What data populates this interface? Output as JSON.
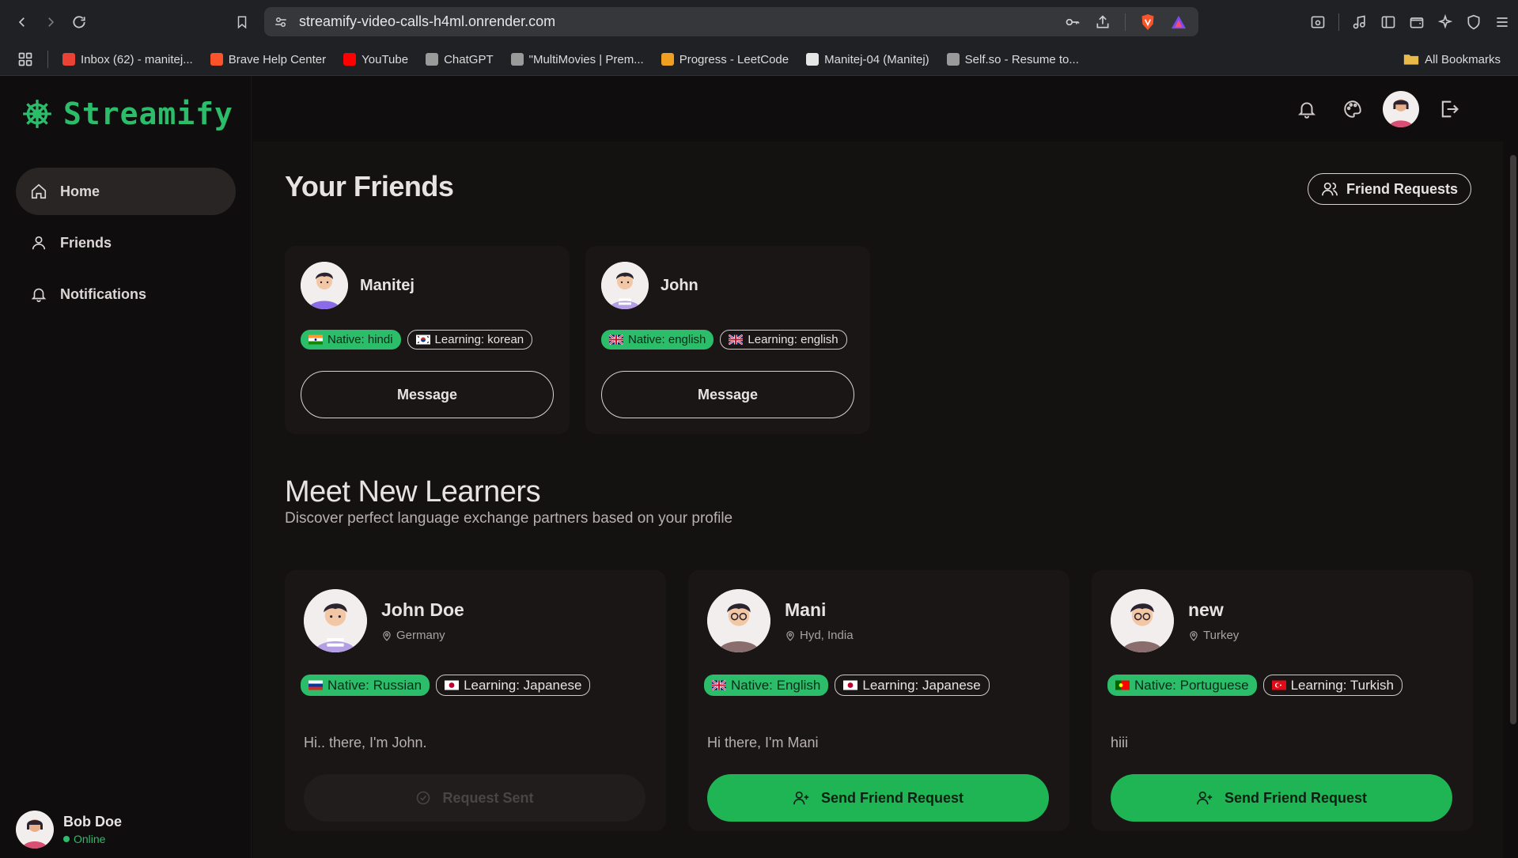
{
  "browser": {
    "url": "streamify-video-calls-h4ml.onrender.com",
    "bookmarks": [
      {
        "label": "Inbox (62) - manitej...",
        "color": "#ea4335"
      },
      {
        "label": "Brave Help Center",
        "color": "#fb542b"
      },
      {
        "label": "YouTube",
        "color": "#ff0000"
      },
      {
        "label": "ChatGPT",
        "color": "#9a9a9a"
      },
      {
        "label": "\"MultiMovies | Prem...",
        "color": "#9a9a9a"
      },
      {
        "label": "Progress - LeetCode",
        "color": "#f0a020"
      },
      {
        "label": "Manitej-04 (Manitej)",
        "color": "#e6e6e6"
      },
      {
        "label": "Self.so - Resume to...",
        "color": "#9a9a9a"
      }
    ],
    "all_bookmarks": "All Bookmarks"
  },
  "app": {
    "name": "Streamify",
    "accent": "#2bbd6a",
    "nav": [
      {
        "label": "Home",
        "icon": "home-icon",
        "active": true
      },
      {
        "label": "Friends",
        "icon": "user-icon",
        "active": false
      },
      {
        "label": "Notifications",
        "icon": "bell-icon",
        "active": false
      }
    ],
    "user": {
      "name": "Bob Doe",
      "status": "Online"
    }
  },
  "friends_section": {
    "title": "Your Friends",
    "requests_button": "Friend Requests",
    "friends": [
      {
        "name": "Manitej",
        "native": "Native: hindi",
        "learning": "Learning: korean",
        "native_flag": "india",
        "learning_flag": "korea",
        "message": "Message"
      },
      {
        "name": "John",
        "native": "Native: english",
        "learning": "Learning: english",
        "native_flag": "uk",
        "learning_flag": "uk",
        "message": "Message"
      }
    ]
  },
  "learners_section": {
    "title": "Meet New Learners",
    "subtitle": "Discover perfect language exchange partners based on your profile",
    "learners": [
      {
        "name": "John Doe",
        "location": "Germany",
        "native": "Native: Russian",
        "learning": "Learning: Japanese",
        "native_flag": "russia",
        "learning_flag": "japan",
        "bio": "Hi.. there, I'm John.",
        "button": "Request Sent",
        "sent": true
      },
      {
        "name": "Mani",
        "location": "Hyd, India",
        "native": "Native: English",
        "learning": "Learning: Japanese",
        "native_flag": "uk",
        "learning_flag": "japan",
        "bio": "Hi there, I'm Mani",
        "button": "Send Friend Request",
        "sent": false
      },
      {
        "name": "new",
        "location": "Turkey",
        "native": "Native: Portuguese",
        "learning": "Learning: Turkish",
        "native_flag": "portugal",
        "learning_flag": "turkey",
        "bio": "hiii",
        "button": "Send Friend Request",
        "sent": false
      }
    ]
  }
}
